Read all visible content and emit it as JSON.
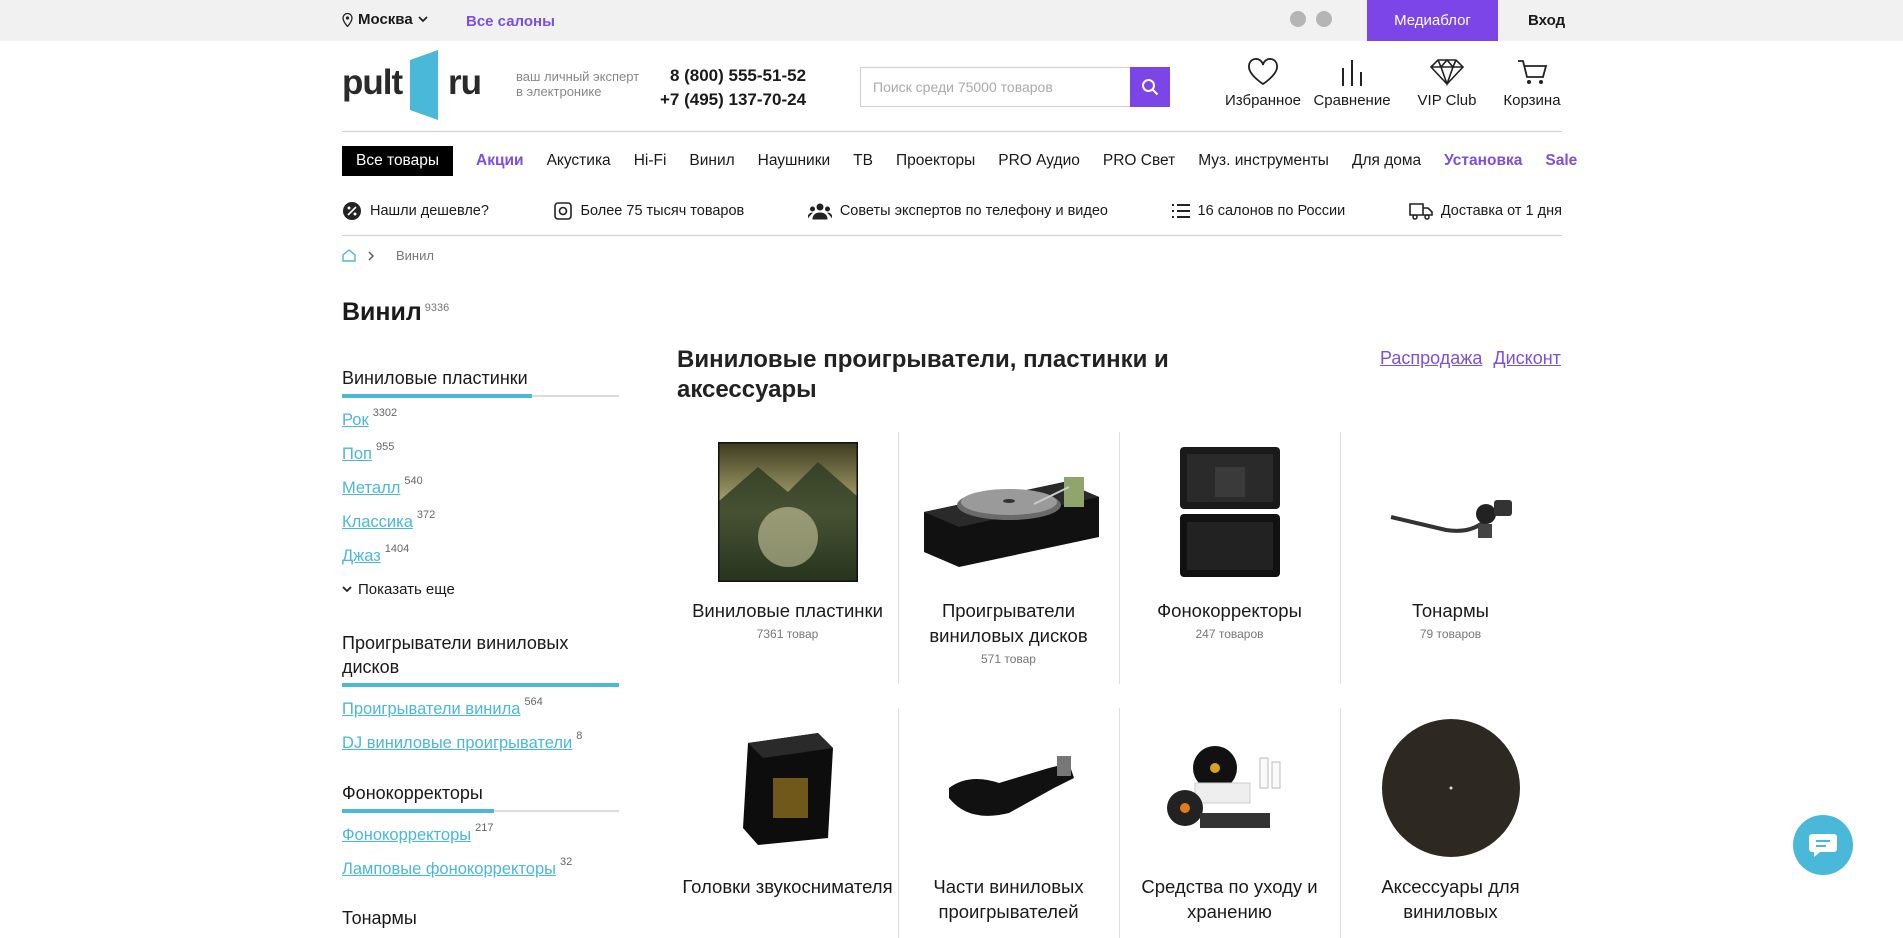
{
  "topbar": {
    "city": "Москва",
    "salons": "Все салоны",
    "mediablog": "Медиаблог",
    "login": "Вход"
  },
  "header": {
    "logo_left": "pult",
    "logo_right": "ru",
    "tagline_1": "ваш личный эксперт",
    "tagline_2": "в электронике",
    "phone_1": "8 (800) 555-51-52",
    "phone_2": "+7 (495) 137-70-24",
    "search_placeholder": "Поиск среди 75000 товаров",
    "icons": [
      {
        "label": "Избранное",
        "icon": "heart-icon"
      },
      {
        "label": "Сравнение",
        "icon": "compare-icon"
      },
      {
        "label": "VIP Club",
        "icon": "diamond-icon"
      },
      {
        "label": "Корзина",
        "icon": "cart-icon"
      }
    ]
  },
  "nav": {
    "all": "Все товары",
    "items": [
      "Акции",
      "Акустика",
      "Hi-Fi",
      "Винил",
      "Наушники",
      "ТВ",
      "Проекторы",
      "PRO Аудио",
      "PRO Свет",
      "Муз. инструменты",
      "Для дома",
      "Установка",
      "Sale"
    ],
    "accent_color": "#7b4fe0"
  },
  "features": [
    {
      "label": "Нашли дешевле?",
      "icon": "percent-icon"
    },
    {
      "label": "Более 75 тысяч товаров",
      "icon": "box-icon"
    },
    {
      "label": "Советы экспертов по телефону и видео",
      "icon": "people-icon"
    },
    {
      "label": "16 салонов по России",
      "icon": "list-icon"
    },
    {
      "label": "Доставка от 1 дня",
      "icon": "truck-icon"
    }
  ],
  "breadcrumb": {
    "current": "Винил"
  },
  "page": {
    "title": "Винил",
    "count": "9336"
  },
  "sidebar": {
    "sections": [
      {
        "title": "Виниловые пластинки",
        "links": [
          {
            "label": "Рок",
            "count": "3302"
          },
          {
            "label": "Поп",
            "count": "955"
          },
          {
            "label": "Металл",
            "count": "540"
          },
          {
            "label": "Классика",
            "count": "372"
          },
          {
            "label": "Джаз",
            "count": "1404"
          }
        ],
        "more": "Показать еще"
      },
      {
        "title": "Проигрыватели виниловых дисков",
        "links": [
          {
            "label": "Проигрыватели винила",
            "count": "564"
          },
          {
            "label": "DJ виниловые проигрыватели",
            "count": "8"
          }
        ]
      },
      {
        "title": "Фонокорректоры",
        "links": [
          {
            "label": "Фонокорректоры",
            "count": "217"
          },
          {
            "label": "Ламповые фонокорректоры",
            "count": "32"
          }
        ]
      },
      {
        "title": "Тонармы",
        "links": []
      }
    ]
  },
  "content": {
    "title": "Виниловые проигрыватели, пластинки и аксессуары",
    "links": [
      "Распродажа",
      "Дисконт"
    ],
    "cards": [
      {
        "name": "Виниловые пластинки",
        "count": "7361 товар"
      },
      {
        "name": "Проигрыватели виниловых дисков",
        "count": "571 товар"
      },
      {
        "name": "Фонокорректоры",
        "count": "247 товаров"
      },
      {
        "name": "Тонармы",
        "count": "79 товаров"
      },
      {
        "name": "Головки звукоснимателя",
        "count": ""
      },
      {
        "name": "Части виниловых проигрывателей",
        "count": ""
      },
      {
        "name": "Средства по уходу и хранению",
        "count": ""
      },
      {
        "name": "Аксессуары для виниловых",
        "count": ""
      }
    ]
  }
}
